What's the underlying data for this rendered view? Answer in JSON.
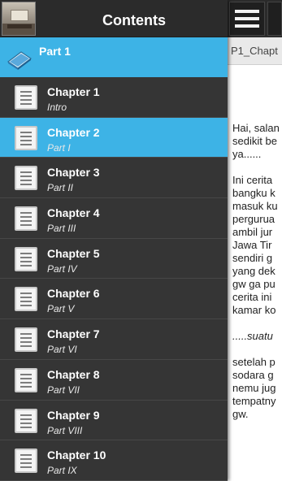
{
  "drawer": {
    "title": "Contents",
    "part": {
      "label": "Part 1"
    },
    "chapters": [
      {
        "title": "Chapter 1",
        "subtitle": "Intro",
        "selected": false
      },
      {
        "title": "Chapter 2",
        "subtitle": "Part I",
        "selected": true
      },
      {
        "title": "Chapter 3",
        "subtitle": "Part II",
        "selected": false
      },
      {
        "title": "Chapter 4",
        "subtitle": "Part III",
        "selected": false
      },
      {
        "title": "Chapter 5",
        "subtitle": "Part IV",
        "selected": false
      },
      {
        "title": "Chapter 6",
        "subtitle": "Part V",
        "selected": false
      },
      {
        "title": "Chapter 7",
        "subtitle": "Part VI",
        "selected": false
      },
      {
        "title": "Chapter 8",
        "subtitle": "Part VII",
        "selected": false
      },
      {
        "title": "Chapter 9",
        "subtitle": "Part VIII",
        "selected": false
      },
      {
        "title": "Chapter 10",
        "subtitle": "Part IX",
        "selected": false
      }
    ]
  },
  "reader": {
    "tab_label": "P1_Chapt",
    "lines": [
      "Hai, salan",
      "sedikit be",
      "ya......",
      "Ini cerita",
      "bangku k",
      "masuk ku",
      "pergurua",
      "ambil jur",
      "Jawa Tir",
      "sendiri g",
      "yang dek",
      "gw ga pu",
      "cerita ini",
      "kamar ko",
      ".....suatu",
      "setelah p",
      "sodara g",
      "nemu jug",
      "tempatny",
      "gw."
    ]
  },
  "colors": {
    "accent": "#3db3e6",
    "drawer_bg": "#353535",
    "header_bg": "#2b2b2b",
    "reader_bg": "#ffffff"
  },
  "icons": {
    "app_thumbnail": "room-photo",
    "menu": "hamburger-icon",
    "part": "book-icon",
    "chapter": "document-icon"
  }
}
